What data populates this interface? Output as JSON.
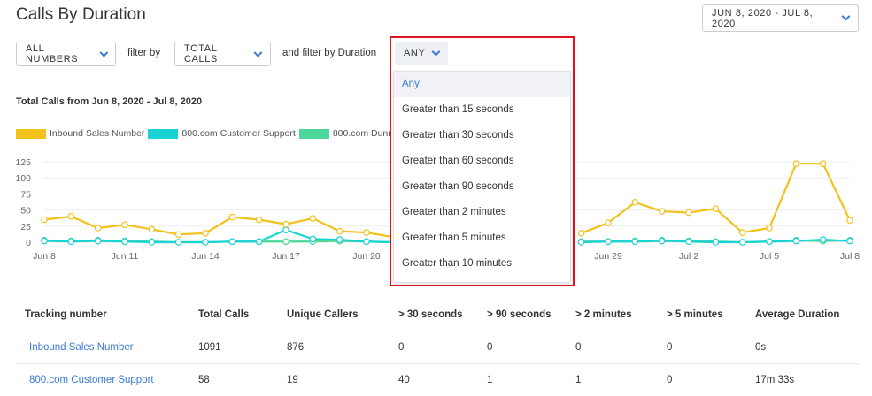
{
  "page": {
    "title": "Calls By Duration"
  },
  "date_range": {
    "label": "JUN 8, 2020 - JUL 8, 2020"
  },
  "filters": {
    "numbers_label": "ALL NUMBERS",
    "filter_by_text": "filter by",
    "metric_label": "TOTAL CALLS",
    "duration_text": "and filter by Duration",
    "duration_label": "ANY",
    "duration_options": [
      "Any",
      "Greater than 15 seconds",
      "Greater than 30 seconds",
      "Greater than 60 seconds",
      "Greater than 90 seconds",
      "Greater than 2 minutes",
      "Greater than 5 minutes",
      "Greater than 10 minutes"
    ],
    "duration_selected_index": 0
  },
  "colors": {
    "accent": "#3a7bd5",
    "series_inbound": "#f2c21b",
    "series_support": "#19d3d3",
    "series_dunning": "#4cd89a",
    "highlight_border": "#e0141e"
  },
  "icons": [
    "chevron-down-icon"
  ],
  "chart_data": {
    "type": "line",
    "title": "Total Calls from Jun 8, 2020 - Jul 8, 2020",
    "x_ticks": [
      "Jun 8",
      "Jun 11",
      "Jun 14",
      "Jun 17",
      "Jun 20",
      "Jun 29",
      "Jul 2",
      "Jul 5",
      "Jul 8"
    ],
    "x_tick_days": [
      0,
      3,
      6,
      9,
      12,
      21,
      24,
      27,
      30
    ],
    "ylim": [
      0,
      125
    ],
    "y_ticks": [
      0,
      25,
      50,
      75,
      100,
      125
    ],
    "grid": true,
    "legend_position": "top-left",
    "x": [
      0,
      1,
      2,
      3,
      4,
      5,
      6,
      7,
      8,
      9,
      10,
      11,
      12,
      13,
      14,
      15,
      16,
      17,
      18,
      19,
      20,
      21,
      22,
      23,
      24,
      25,
      26,
      27,
      28,
      29,
      30
    ],
    "series": [
      {
        "name": "Inbound Sales Number",
        "values": [
          35,
          40,
          22,
          27,
          20,
          12,
          14,
          39,
          35,
          28,
          37,
          17,
          15,
          8,
          null,
          null,
          null,
          null,
          null,
          null,
          14,
          30,
          62,
          48,
          46,
          52,
          15,
          22,
          122,
          122,
          34
        ]
      },
      {
        "name": "800.com Customer Support",
        "values": [
          2,
          1,
          2,
          1,
          0,
          0,
          0,
          1,
          1,
          19,
          5,
          4,
          1,
          0,
          null,
          null,
          null,
          null,
          null,
          null,
          0,
          1,
          1,
          2,
          1,
          0,
          0,
          1,
          2,
          4,
          2
        ]
      },
      {
        "name": "800.com Dunning",
        "values": [
          3,
          2,
          3,
          2,
          1,
          0,
          0,
          1,
          1,
          1,
          1,
          2,
          1,
          0,
          null,
          null,
          null,
          null,
          null,
          null,
          1,
          1,
          2,
          3,
          2,
          1,
          0,
          1,
          3,
          2,
          3
        ]
      }
    ]
  },
  "table": {
    "headers": [
      "Tracking number",
      "Total Calls",
      "Unique Callers",
      "> 30 seconds",
      "> 90 seconds",
      "> 2 minutes",
      "> 5 minutes",
      "Average Duration"
    ],
    "rows": [
      [
        "Inbound Sales Number",
        "1091",
        "876",
        "0",
        "0",
        "0",
        "0",
        "0s"
      ],
      [
        "800.com Customer Support",
        "58",
        "19",
        "40",
        "1",
        "1",
        "0",
        "17m 33s"
      ]
    ]
  }
}
